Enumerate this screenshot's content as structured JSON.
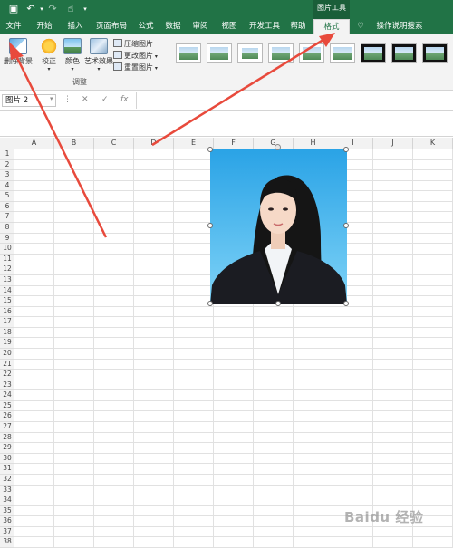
{
  "quick_access": {
    "save_icon": "save-icon",
    "undo_icon": "undo-icon",
    "redo_icon": "redo-icon",
    "touch_icon": "touch-mode-icon"
  },
  "context_title": "图片工具",
  "tabs": [
    {
      "label": "文件"
    },
    {
      "label": "开始"
    },
    {
      "label": "插入"
    },
    {
      "label": "页面布局"
    },
    {
      "label": "公式"
    },
    {
      "label": "数据"
    },
    {
      "label": "审阅"
    },
    {
      "label": "视图"
    },
    {
      "label": "开发工具"
    },
    {
      "label": "帮助"
    },
    {
      "label": "格式"
    }
  ],
  "tell_me": "操作说明搜索",
  "ribbon": {
    "remove_background": "删除背景",
    "corrections": "校正",
    "color": "颜色",
    "artistic_effects": "艺术效果",
    "compress": "压缩图片",
    "change": "更改图片",
    "reset": "重置图片",
    "group_label": "调整"
  },
  "name_box": "图片 2",
  "fx_label": "fx",
  "columns": [
    "A",
    "B",
    "C",
    "D",
    "E",
    "F",
    "G",
    "H",
    "I",
    "J",
    "K"
  ],
  "rows": [
    "1",
    "2",
    "3",
    "4",
    "5",
    "6",
    "7",
    "8",
    "9",
    "10",
    "11",
    "12",
    "13",
    "14",
    "15",
    "16",
    "17",
    "18",
    "19",
    "20",
    "21",
    "22",
    "23",
    "24",
    "25",
    "26",
    "27",
    "28",
    "29",
    "30",
    "31",
    "32",
    "33",
    "34",
    "35",
    "36",
    "37",
    "38"
  ],
  "watermark": "Baidu 经验",
  "colors": {
    "excel_green": "#217346",
    "arrow_red": "#e84a3c",
    "photo_bg": "#3fb4ec"
  }
}
